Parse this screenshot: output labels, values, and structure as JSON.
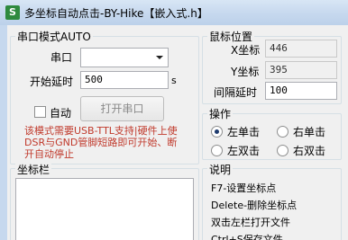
{
  "window": {
    "icon_glyph": "S",
    "title": "多坐标自动点击-BY-Hike【嵌入式.h】"
  },
  "serial_group": {
    "title": "串口模式AUTO",
    "port_label": "串口",
    "port_value": "",
    "delay_label": "开始延时",
    "delay_value": "500",
    "delay_unit": "s",
    "auto_label": "自动",
    "auto_checked": false,
    "open_button": "打开串口",
    "note_lines": [
      "该模式需要USB-TTL支持|硬件上使",
      "DSR与GND管脚短路即可开始、断",
      "开自动停止"
    ]
  },
  "mouse_group": {
    "title": "鼠标位置",
    "x_label": "X坐标",
    "x_value": "446",
    "y_label": "Y坐标",
    "y_value": "395",
    "interval_label": "间隔延时",
    "interval_value": "100"
  },
  "action_group": {
    "title": "操作",
    "options": [
      "左单击",
      "右单击",
      "左双击",
      "右双击"
    ],
    "selected": "左单击"
  },
  "coords_group": {
    "title": "坐标栏"
  },
  "help_group": {
    "title": "说明",
    "lines": [
      "F7-设置坐标点",
      "Delete-删除坐标点",
      "双击左栏打开文件",
      "Ctrl+S保存文件"
    ]
  }
}
